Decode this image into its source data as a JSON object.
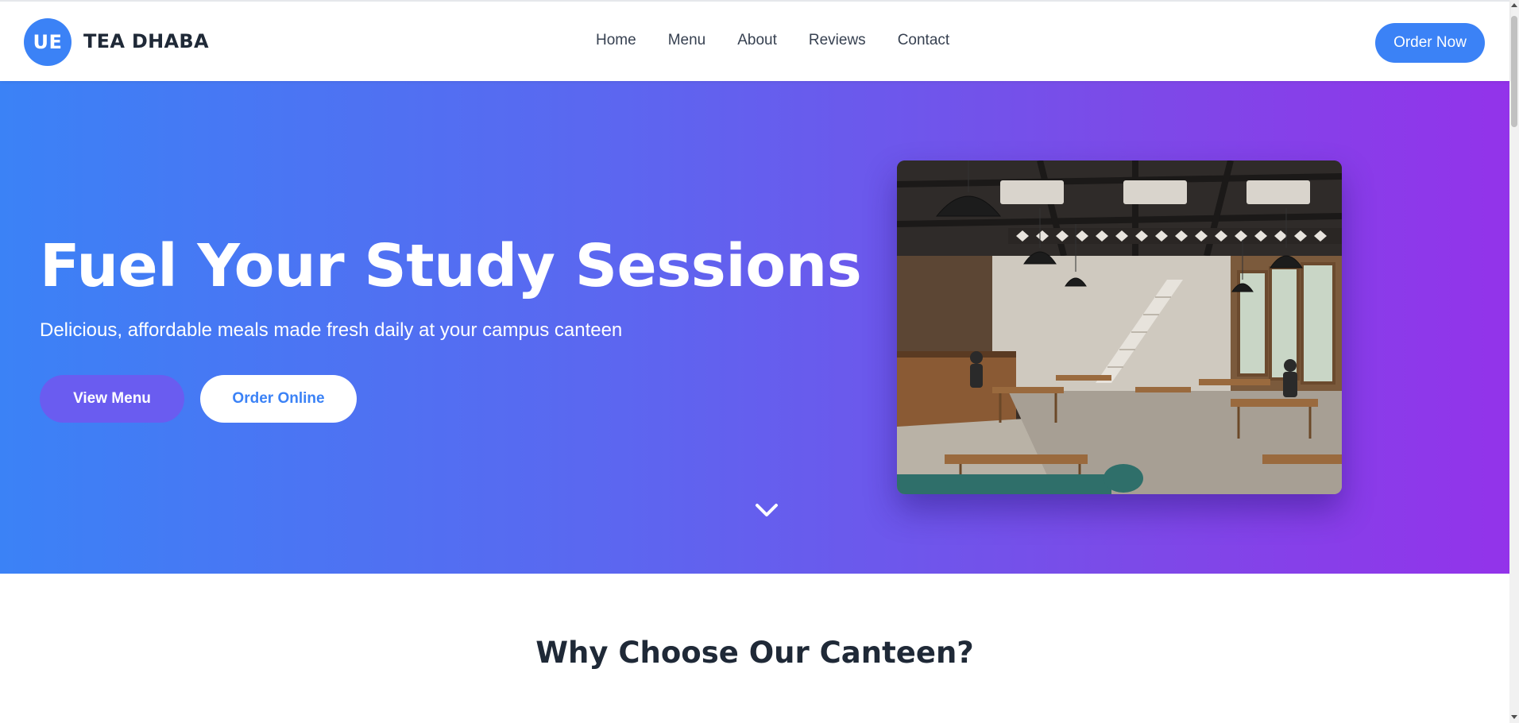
{
  "brand": {
    "initials": "UE",
    "name": "TEA DHABA",
    "accent_color": "#3b82f6"
  },
  "nav": {
    "items": [
      {
        "label": "Home"
      },
      {
        "label": "Menu"
      },
      {
        "label": "About"
      },
      {
        "label": "Reviews"
      },
      {
        "label": "Contact"
      }
    ],
    "cta_label": "Order Now"
  },
  "hero": {
    "title": "Fuel Your Study Sessions",
    "subtitle": "Delicious, affordable meals made fresh daily at your campus canteen",
    "primary_button": "View Menu",
    "secondary_button": "Order Online",
    "image_alt": "Canteen interior photo",
    "gradient_start": "#3b82f6",
    "gradient_end": "#9333ea",
    "scroll_icon": "chevron-down-icon"
  },
  "features": {
    "title": "Why Choose Our Canteen?"
  }
}
